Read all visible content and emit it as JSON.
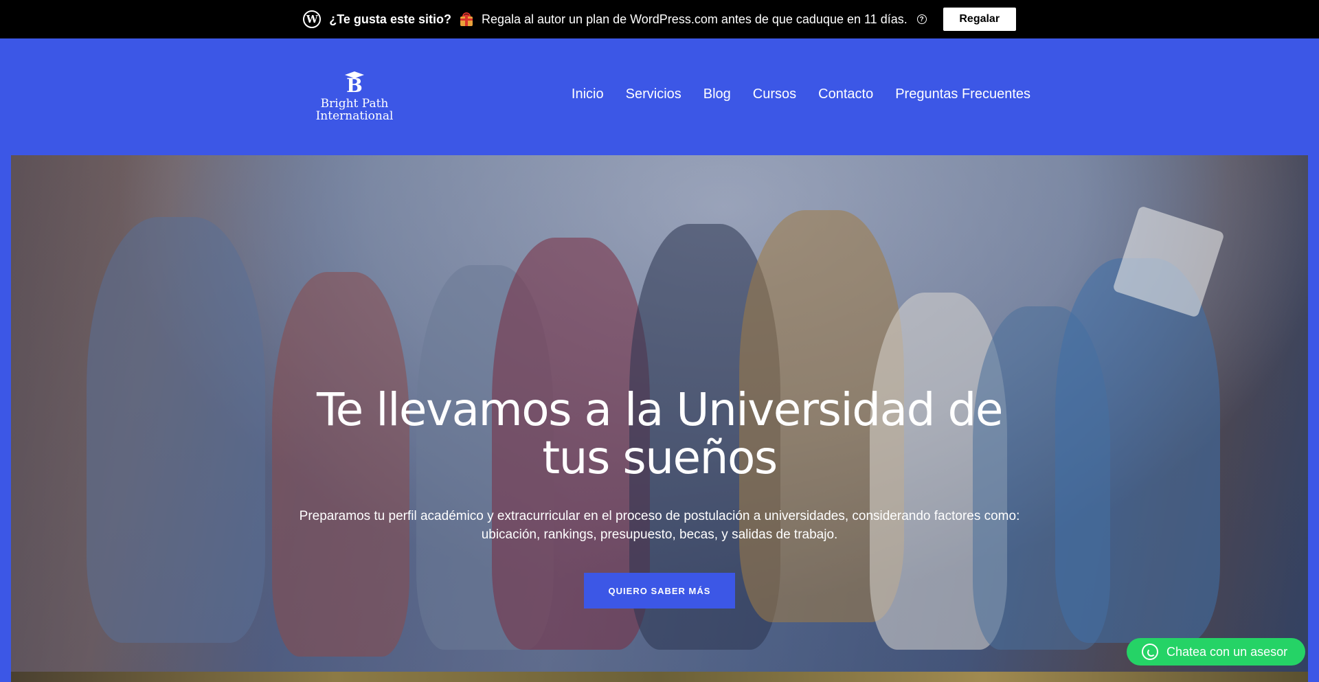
{
  "promo": {
    "icon": "wordpress-icon",
    "question": "¿Te gusta este sitio?",
    "gift_icon": "gift-icon",
    "message": "Regala al autor un plan de WordPress.com antes de que caduque en 11 días.",
    "help_icon": "help-icon",
    "button_label": "Regalar"
  },
  "header": {
    "logo": {
      "letter": "B",
      "line1": "Bright Path",
      "line2": "International"
    },
    "nav": [
      "Inicio",
      "Servicios",
      "Blog",
      "Cursos",
      "Contacto",
      "Preguntas Frecuentes"
    ]
  },
  "hero": {
    "title": "Te llevamos a la Universidad de tus sueños",
    "subtitle": "Preparamos tu perfil académico y extracurricular en el proceso de postulación a universidades, considerando factores como: ubicación, rankings, presupuesto, becas, y salidas de trabajo.",
    "cta_label": "QUIERO SABER MÁS"
  },
  "chat": {
    "icon": "whatsapp-icon",
    "label": "Chatea con un asesor"
  },
  "colors": {
    "brand_blue": "#3c57e6",
    "promo_bg": "#000000",
    "chat_green": "#25d366"
  }
}
